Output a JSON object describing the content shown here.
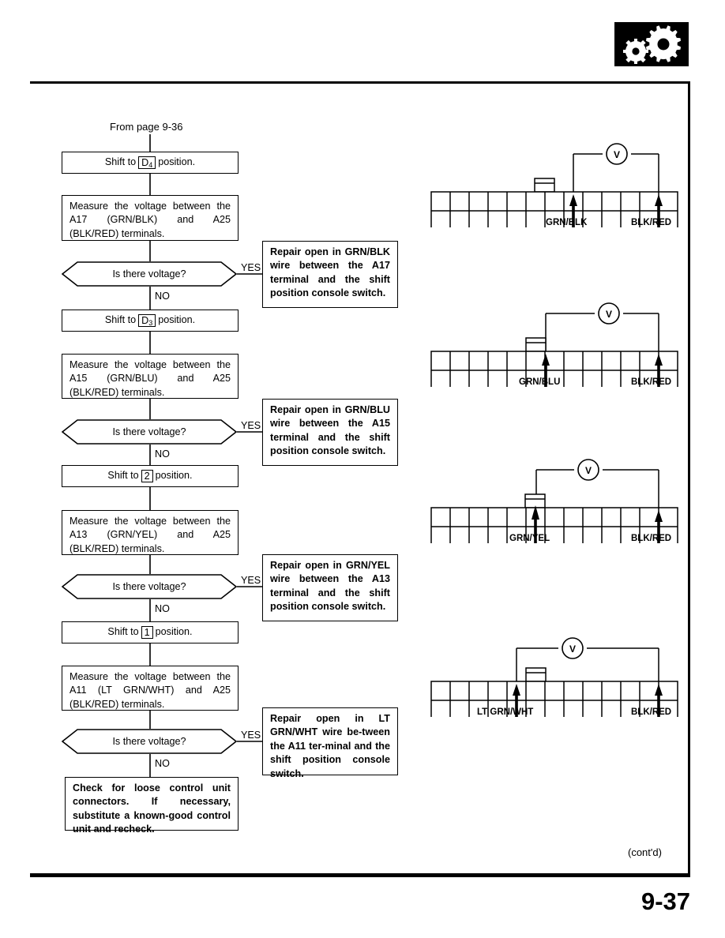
{
  "page": {
    "number": "9-37",
    "contd": "(cont'd)",
    "logo_icon": "gears-icon"
  },
  "flowchart": {
    "from_label": "From page 9-36",
    "steps": [
      {
        "id": "shift-d4",
        "type": "process",
        "text_before": "Shift to",
        "gear": "D",
        "gear_sub": "4",
        "text_after": "position."
      },
      {
        "id": "measure-a17",
        "type": "process",
        "text": "Measure the voltage between the A17 (GRN/BLK) and A25 (BLK/RED) terminals."
      },
      {
        "id": "decision-1",
        "type": "decision",
        "text": "Is there voltage?",
        "yes_label": "YES",
        "no_label": "NO"
      },
      {
        "id": "shift-d3",
        "type": "process",
        "text_before": "Shift to",
        "gear": "D",
        "gear_sub": "3",
        "text_after": "position."
      },
      {
        "id": "measure-a15",
        "type": "process",
        "text": "Measure the voltage between the A15 (GRN/BLU) and A25 (BLK/RED) terminals."
      },
      {
        "id": "decision-2",
        "type": "decision",
        "text": "Is there voltage?",
        "yes_label": "YES",
        "no_label": "NO"
      },
      {
        "id": "shift-2",
        "type": "process",
        "text_before": "Shift to",
        "gear": "2",
        "gear_sub": "",
        "text_after": "position."
      },
      {
        "id": "measure-a13",
        "type": "process",
        "text": "Measure the voltage between the A13 (GRN/YEL) and A25 (BLK/RED) terminals."
      },
      {
        "id": "decision-3",
        "type": "decision",
        "text": "Is there voltage?",
        "yes_label": "YES",
        "no_label": "NO"
      },
      {
        "id": "shift-1",
        "type": "process",
        "text_before": "Shift to",
        "gear": "1",
        "gear_sub": "",
        "text_after": "position."
      },
      {
        "id": "measure-a11",
        "type": "process",
        "text": "Measure the voltage between the A11 (LT GRN/WHT) and A25 (BLK/RED) terminals."
      },
      {
        "id": "decision-4",
        "type": "decision",
        "text": "Is there voltage?",
        "yes_label": "YES",
        "no_label": "NO"
      },
      {
        "id": "final-check",
        "type": "process-bold",
        "text": "Check for loose control unit connectors. If necessary, substitute a known-good control unit and recheck."
      }
    ],
    "repairs": [
      {
        "id": "repair-a17",
        "text": "Repair open in GRN/BLK wire between the A17 terminal and the shift position console switch."
      },
      {
        "id": "repair-a15",
        "text": "Repair open in GRN/BLU wire between the A15 terminal and the shift position console switch."
      },
      {
        "id": "repair-a13",
        "text": "Repair open in GRN/YEL wire between the A13 terminal and the shift position console switch."
      },
      {
        "id": "repair-a11",
        "text": "Repair open in LT GRN/WHT wire be-tween the A11 ter-minal and the shift position console switch."
      }
    ]
  },
  "connectors": [
    {
      "id": "connector-d4",
      "meter_label": "V",
      "left_probe_label": "GRN/BLK",
      "right_probe_label": "BLK/RED"
    },
    {
      "id": "connector-d3",
      "meter_label": "V",
      "left_probe_label": "GRN/BLU",
      "right_probe_label": "BLK/RED"
    },
    {
      "id": "connector-2",
      "meter_label": "V",
      "left_probe_label": "GRN/YEL",
      "right_probe_label": "BLK/RED"
    },
    {
      "id": "connector-1",
      "meter_label": "V",
      "left_probe_label": "LT GRN/WHT",
      "right_probe_label": "BLK/RED"
    }
  ]
}
